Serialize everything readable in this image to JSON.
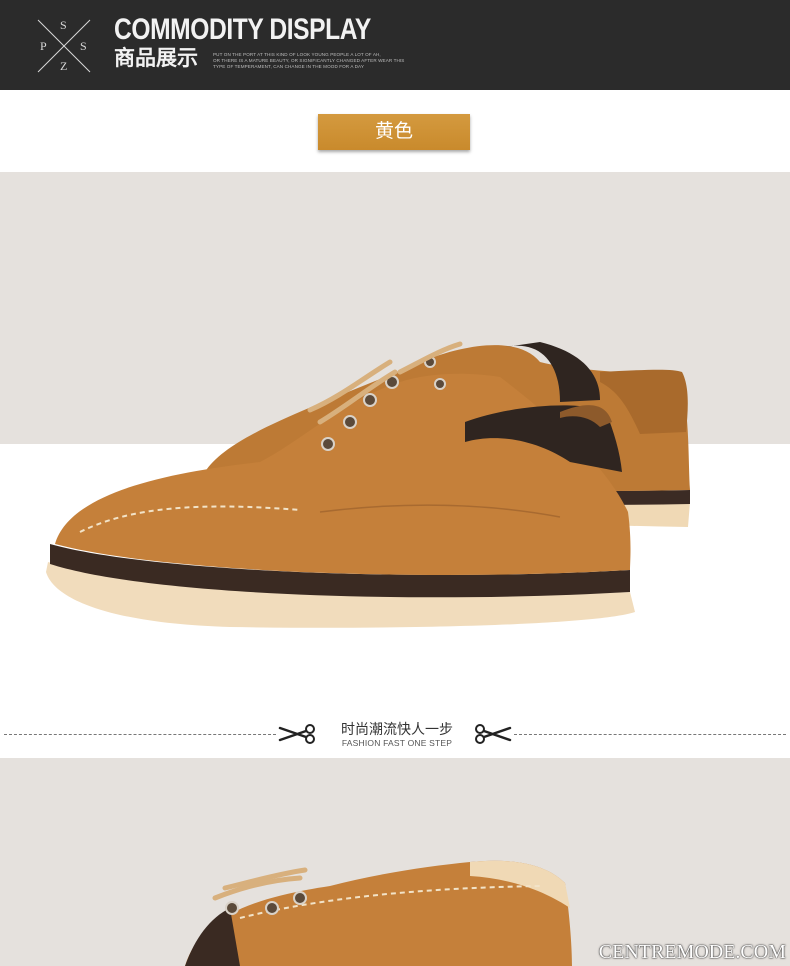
{
  "header": {
    "logo_letters": [
      "S",
      "P",
      "S",
      "Z"
    ],
    "title_en": "COMMODITY DISPLAY",
    "title_cn": "商品展示",
    "tagline": "PUT ON THE PORT AT THIS KIND OF LOOK YOUNG PEOPLE A LOT OF AH,\nOR THERE IS A MATURE BEAUTY, OR SIGNIFICANTLY CHANGED AFTER WEAR THIS\nTYPE OF TEMPERAMENT, CAN CHANGE IN THE MOOD FOR A DAY"
  },
  "color_tag": {
    "label": "黄色",
    "color": "#cf9135"
  },
  "divider": {
    "title": "时尚潮流快人一步",
    "subtitle": "FASHION FAST ONE STEP",
    "left_icon": "scissors-icon",
    "right_icon": "scissors-icon"
  },
  "photos": [
    {
      "subject": "shoe-pair-photo",
      "background": "#e5e1dd",
      "shoe_color": "#c5803a"
    },
    {
      "subject": "shoe-closeup-photo",
      "background": "#e5e1dd",
      "shoe_color": "#c5803a"
    }
  ],
  "watermark": "CENTREMODE.COM"
}
